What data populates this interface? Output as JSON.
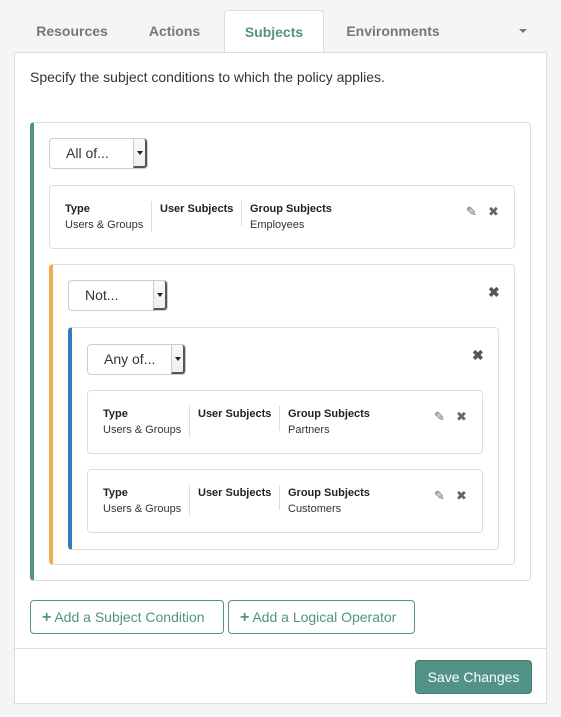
{
  "tabs": [
    {
      "label": "Resources",
      "active": false
    },
    {
      "label": "Actions",
      "active": false
    },
    {
      "label": "Subjects",
      "active": true
    },
    {
      "label": "Environments",
      "active": false
    }
  ],
  "intro": "Specify the subject conditions to which the policy applies.",
  "colors": {
    "accent": "#519387",
    "level1_border": "#519387",
    "level2_border": "#f0ad4e",
    "level3_border": "#337ab7"
  },
  "root_group": {
    "operator": "All of...",
    "condition": {
      "type_label": "Type",
      "type_value": "Users & Groups",
      "user_label": "User Subjects",
      "user_value": "",
      "group_label": "Group Subjects",
      "group_value": "Employees"
    },
    "not_group": {
      "operator": "Not...",
      "any_group": {
        "operator": "Any of...",
        "conditions": [
          {
            "type_label": "Type",
            "type_value": "Users & Groups",
            "user_label": "User Subjects",
            "user_value": "",
            "group_label": "Group Subjects",
            "group_value": "Partners"
          },
          {
            "type_label": "Type",
            "type_value": "Users & Groups",
            "user_label": "User Subjects",
            "user_value": "",
            "group_label": "Group Subjects",
            "group_value": "Customers"
          }
        ]
      }
    }
  },
  "icons": {
    "pencil": "✎",
    "close": "✖",
    "plus": "+"
  },
  "buttons": {
    "add_condition": "Add a Subject Condition",
    "add_operator": "Add a Logical Operator",
    "save": "Save Changes"
  }
}
